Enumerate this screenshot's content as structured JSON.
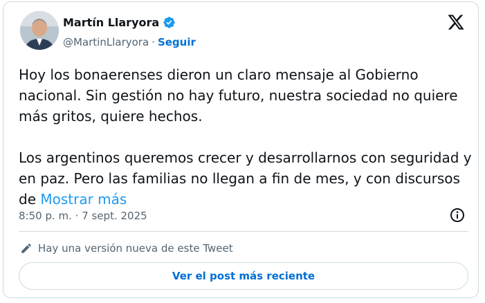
{
  "author": {
    "name": "Martín Llaryora",
    "handle": "@MartinLlaryora",
    "separator": "·",
    "follow_label": "Seguir",
    "verified_color": "#1d9bf0"
  },
  "tweet": {
    "text": "Hoy los bonaerenses dieron un claro mensaje al Gobierno nacional. Sin gestión no hay futuro, nuestra sociedad no quiere más gritos, quiere hechos.\n\nLos argentinos queremos crecer y desarrollarnos con seguridad y en paz. Pero las familias no llegan a fin de mes, y con discursos de ",
    "show_more_label": "Mostrar más",
    "timestamp": "8:50 p. m. · 7 sept. 2025"
  },
  "notice": {
    "text": "Hay una versión nueva de este Tweet"
  },
  "cta": {
    "label": "Ver el post más reciente"
  },
  "icons": {
    "brand": "x-logo-icon",
    "info": "info-icon",
    "edit": "pencil-icon",
    "verified": "verified-badge-icon"
  },
  "colors": {
    "link": "#1d9bf0",
    "follow": "#006fd6",
    "muted": "#536471",
    "text": "#0f1419",
    "border": "#cfd9de"
  }
}
